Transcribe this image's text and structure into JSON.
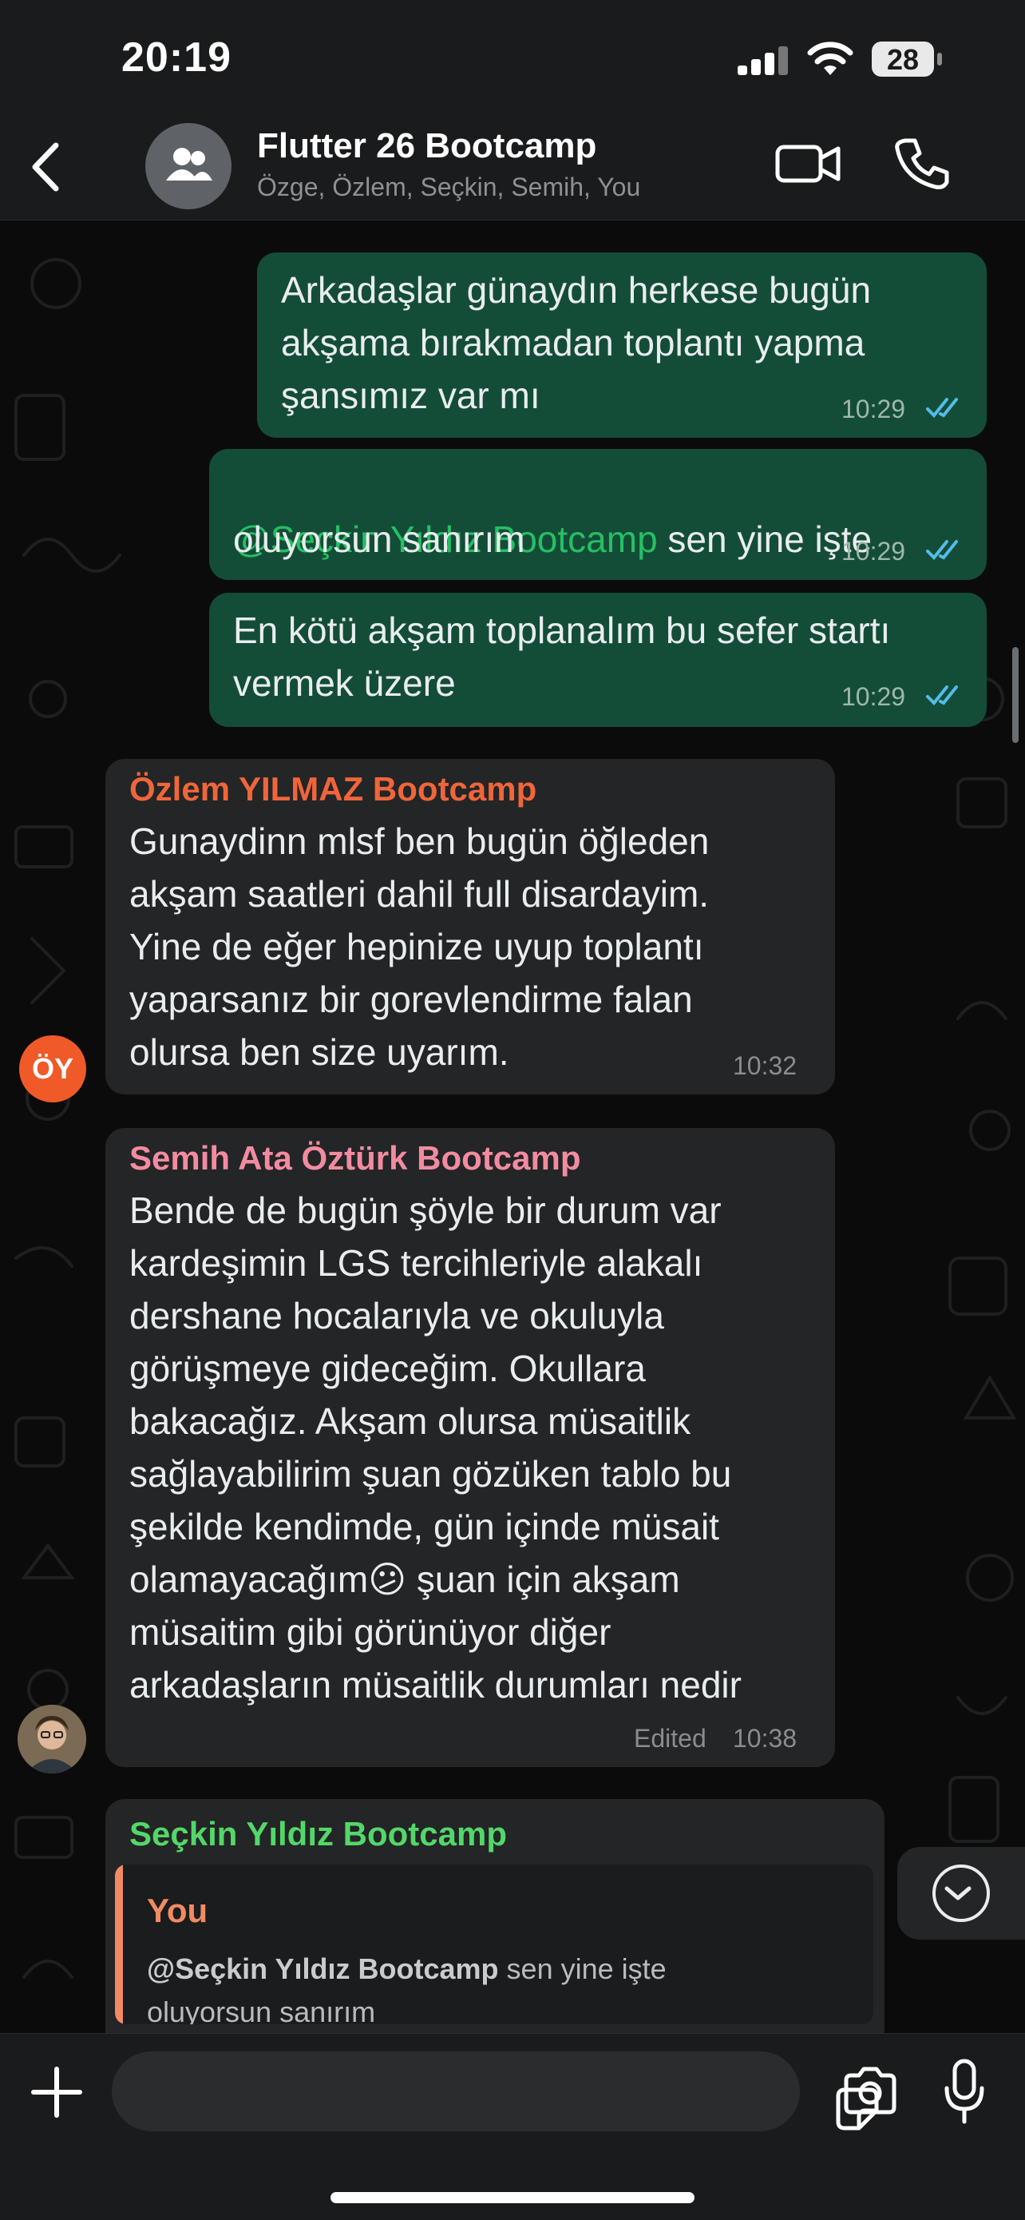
{
  "status_bar": {
    "time": "20:19",
    "battery": "28"
  },
  "header": {
    "title": "Flutter 26 Bootcamp",
    "members": "Özge, Özlem, Seçkin, Semih, You"
  },
  "messages": [
    {
      "type": "outgoing",
      "text": "Arkadaşlar günaydın herkese bugün\nakşama bırakmadan toplantı yapma\nşansımız var mı",
      "time": "10:29",
      "read": true
    },
    {
      "type": "outgoing",
      "mention": "@Seçkin Yıldız Bootcamp",
      "text_after": " sen yine işte",
      "text_line2": "oluyorsun sanırım",
      "time": "10:29",
      "read": true
    },
    {
      "type": "outgoing",
      "text": "En kötü akşam toplanalım bu sefer startı\nvermek üzere",
      "time": "10:29",
      "read": true
    },
    {
      "type": "incoming",
      "sender": "Özlem YILMAZ Bootcamp",
      "sender_color": "#f0653b",
      "avatar_initials": "ÖY",
      "text": "Gunaydinn mlsf ben bugün öğleden\nakşam saatleri dahil full disardayim.\nYine de eğer hepinize uyup toplantı\nyaparsanız bir gorevlendirme falan\nolursa ben size uyarım.",
      "time": "10:32"
    },
    {
      "type": "incoming",
      "sender": "Semih Ata Öztürk Bootcamp",
      "sender_color": "#f38ba0",
      "text_part1": "Bende de bugün şöyle bir durum var\nkardeşimin LGS tercihleriyle alakalı\ndershane hocalarıyla ve okuluyla\ngörüşmeye gideceğim. Okullara\nbakacağız. Akşam olursa müsaitlik\nsağlayabilirim şuan gözüken tablo bu\nşekilde kendimde, gün içinde müsait\nolamayacağım",
      "emoji": "😕",
      "text_part2": " şuan için akşam",
      "text_part3": "müsaitim gibi görünüyor diğer\narkadaşların müsaitlik durumları nedir",
      "edited_label": "Edited",
      "time": "10:38"
    },
    {
      "type": "incoming",
      "sender": "Seçkin Yıldız Bootcamp",
      "sender_color": "#53d769",
      "quote_author": "You",
      "quote_mention": "@Seçkin Yıldız Bootcamp",
      "quote_text": " sen yine işte\noluyorsun sanırım"
    }
  ],
  "colors": {
    "outgoing_bubble": "#144d37",
    "incoming_bubble": "#232526",
    "read_ticks": "#53bdeb",
    "mention": "#25c064"
  },
  "icons": [
    "back-chevron-icon",
    "group-avatar-icon",
    "video-call-icon",
    "phone-icon",
    "plus-icon",
    "sticker-icon",
    "camera-icon",
    "microphone-icon",
    "chevron-down-icon"
  ]
}
